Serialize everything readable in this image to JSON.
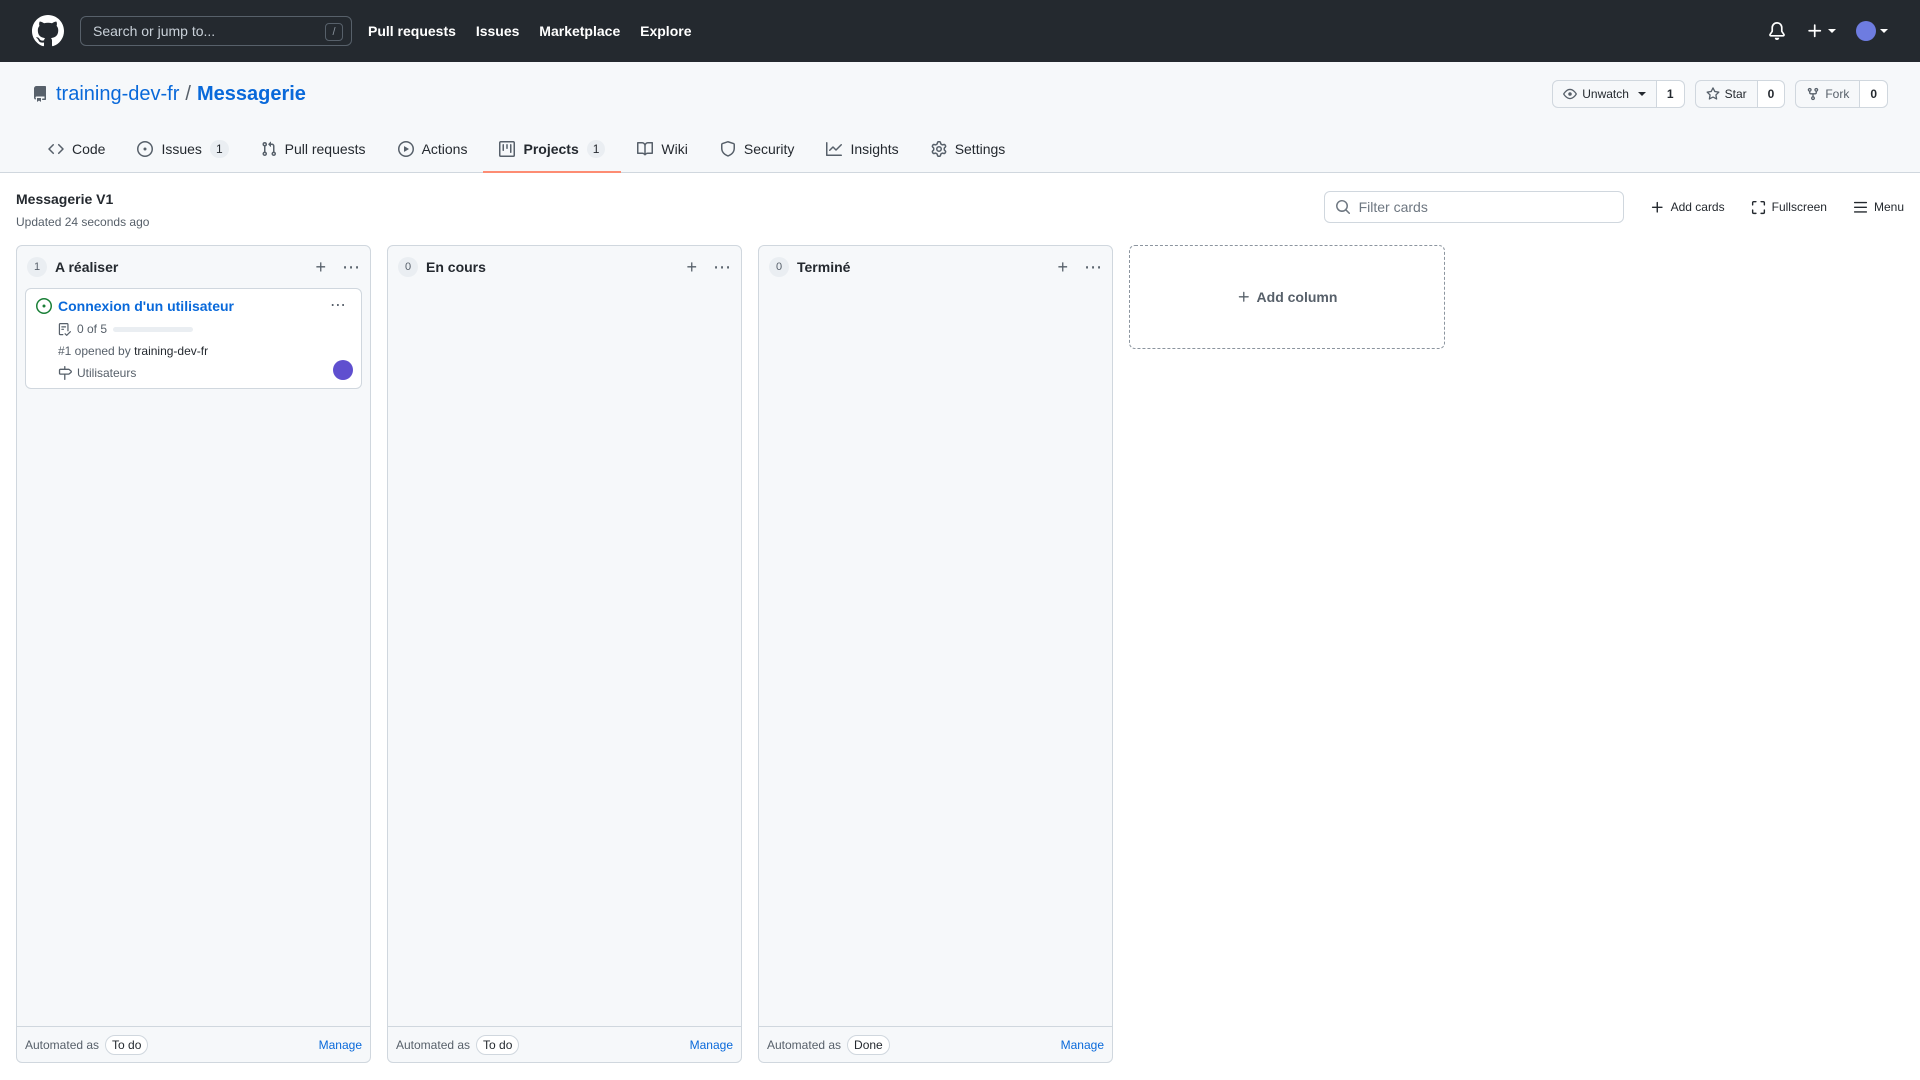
{
  "header": {
    "search_placeholder": "Search or jump to...",
    "search_shortcut": "/",
    "nav": [
      "Pull requests",
      "Issues",
      "Marketplace",
      "Explore"
    ]
  },
  "repo": {
    "owner": "training-dev-fr",
    "separator": "/",
    "name": "Messagerie",
    "watch": {
      "label": "Unwatch",
      "count": "1"
    },
    "star": {
      "label": "Star",
      "count": "0"
    },
    "fork": {
      "label": "Fork",
      "count": "0"
    }
  },
  "tabs": [
    {
      "label": "Code",
      "icon": "code-icon"
    },
    {
      "label": "Issues",
      "count": "1",
      "icon": "issue-icon"
    },
    {
      "label": "Pull requests",
      "icon": "pull-request-icon"
    },
    {
      "label": "Actions",
      "icon": "play-icon"
    },
    {
      "label": "Projects",
      "count": "1",
      "icon": "project-icon",
      "active": true
    },
    {
      "label": "Wiki",
      "icon": "book-icon"
    },
    {
      "label": "Security",
      "icon": "shield-icon"
    },
    {
      "label": "Insights",
      "icon": "graph-icon"
    },
    {
      "label": "Settings",
      "icon": "gear-icon"
    }
  ],
  "project": {
    "name": "Messagerie V1",
    "updated": "Updated 24 seconds ago",
    "filter_placeholder": "Filter cards",
    "add_cards": "Add cards",
    "fullscreen": "Fullscreen",
    "menu": "Menu"
  },
  "columns": [
    {
      "count": "1",
      "title": "A réaliser",
      "automated_label": "Automated as",
      "automated_value": "To do",
      "manage": "Manage",
      "cards": [
        {
          "title": "Connexion d'un utilisateur",
          "tasks": "0 of 5",
          "progress": 0,
          "meta_prefix": "#1 opened by",
          "author": "training-dev-fr",
          "milestone": "Utilisateurs"
        }
      ]
    },
    {
      "count": "0",
      "title": "En cours",
      "automated_label": "Automated as",
      "automated_value": "To do",
      "manage": "Manage",
      "cards": []
    },
    {
      "count": "0",
      "title": "Terminé",
      "automated_label": "Automated as",
      "automated_value": "Done",
      "manage": "Manage",
      "cards": []
    }
  ],
  "add_column": "Add column"
}
